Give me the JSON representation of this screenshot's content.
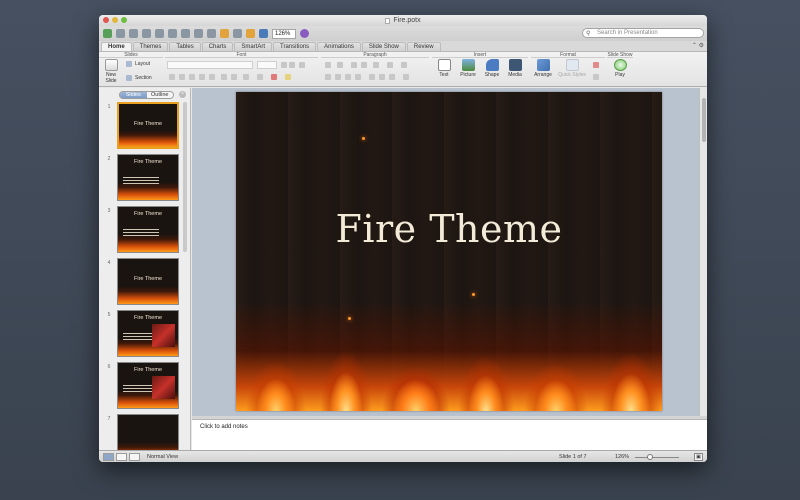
{
  "window": {
    "title": "Fire.potx"
  },
  "toolbar": {
    "zoom_value": "126%"
  },
  "search": {
    "placeholder": "Search in Presentation"
  },
  "ribbon_tabs": [
    "Home",
    "Themes",
    "Tables",
    "Charts",
    "SmartArt",
    "Transitions",
    "Animations",
    "Slide Show",
    "Review"
  ],
  "ribbon": {
    "groups": {
      "slides": "Slides",
      "font": "Font",
      "paragraph": "Paragraph",
      "insert": "Insert",
      "format": "Format",
      "slideshow": "Slide Show"
    },
    "new_slide": "New Slide",
    "layout": "Layout",
    "section": "Section",
    "text": "Text",
    "picture": "Picture",
    "shape": "Shape",
    "media": "Media",
    "arrange": "Arrange",
    "quick_styles": "Quick Styles",
    "play": "Play"
  },
  "left_pane": {
    "segments": [
      "Slides",
      "Outline"
    ],
    "slides": [
      {
        "num": "1",
        "title": "Fire Theme",
        "kind": "title"
      },
      {
        "num": "2",
        "title": "Fire Theme",
        "kind": "bullets"
      },
      {
        "num": "3",
        "title": "Fire Theme",
        "kind": "bullets"
      },
      {
        "num": "4",
        "title": "Fire Theme",
        "kind": "title-low"
      },
      {
        "num": "5",
        "title": "Fire Theme",
        "kind": "pic"
      },
      {
        "num": "6",
        "title": "Fire Theme",
        "kind": "bullets-pic"
      },
      {
        "num": "7",
        "title": "",
        "kind": "empty"
      }
    ]
  },
  "slide": {
    "title": "Fire Theme"
  },
  "notes": {
    "placeholder": "Click to add notes"
  },
  "status": {
    "view": "Normal View",
    "slide_of": "Slide 1 of 7",
    "zoom": "126%"
  },
  "colors": {
    "fire": "#ff8a1c",
    "selection": "#e8a020",
    "slide_bg": "#1c1511"
  }
}
